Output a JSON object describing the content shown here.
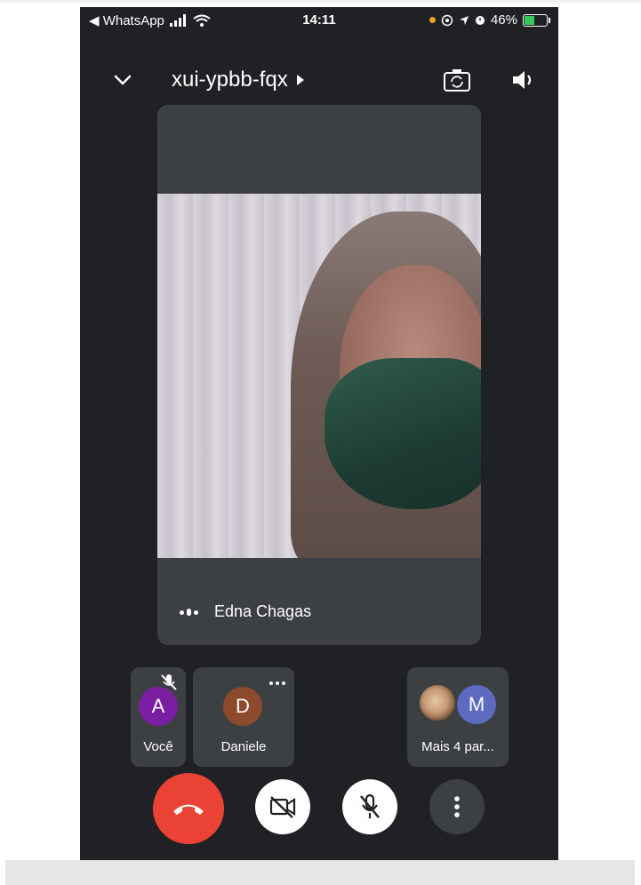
{
  "status_bar": {
    "back_app": "◀ WhatsApp",
    "time": "14:11",
    "battery": "46%",
    "battery_level": 0.46
  },
  "meeting": {
    "code": "xui-ypbb-fqx"
  },
  "main_participant": {
    "name": "Edna Chagas"
  },
  "participants": [
    {
      "initial": "A",
      "label": "Você",
      "avatar_color": "#7b1fa2",
      "muted": true
    },
    {
      "initial": "D",
      "label": "Daniele",
      "avatar_color": "#8d4a2c"
    },
    {
      "initial": "M",
      "label": "Mais 4 par...",
      "avatar_color": "#5c6bc0"
    }
  ],
  "colors": {
    "background": "#202124",
    "tile": "#3c4043",
    "hangup": "#ea4335"
  },
  "icons": {
    "minimize": "chevron-down-icon",
    "switch_camera": "camera-switch-icon",
    "audio": "speaker-icon",
    "hangup": "phone-hangup-icon",
    "camera": "camera-off-icon",
    "mic": "mic-off-icon",
    "more": "more-vert-icon"
  }
}
